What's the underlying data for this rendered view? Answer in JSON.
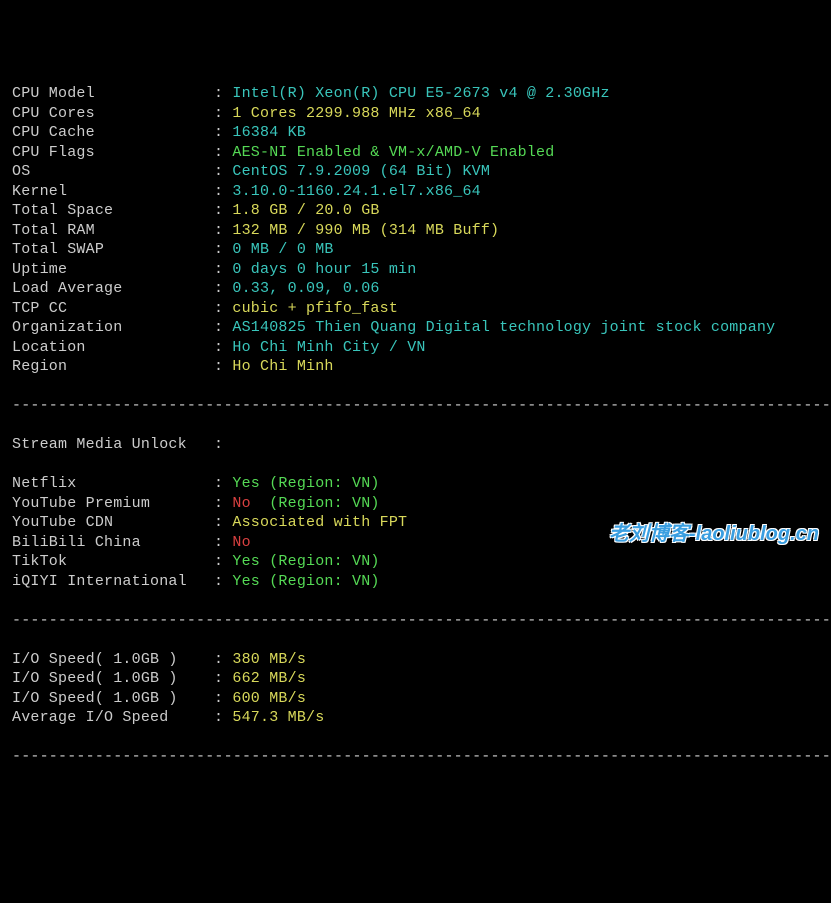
{
  "sysinfo": [
    {
      "label": "CPU Model",
      "value": "Intel(R) Xeon(R) CPU E5-2673 v4 @ 2.30GHz",
      "cls": "teal"
    },
    {
      "label": "CPU Cores",
      "value": "1 Cores 2299.988 MHz x86_64",
      "cls": "yellow"
    },
    {
      "label": "CPU Cache",
      "value": "16384 KB",
      "cls": "teal"
    },
    {
      "label": "CPU Flags",
      "value": "AES-NI Enabled & VM-x/AMD-V Enabled",
      "cls": "green"
    },
    {
      "label": "OS",
      "value": "CentOS 7.9.2009 (64 Bit) KVM",
      "cls": "teal"
    },
    {
      "label": "Kernel",
      "value": "3.10.0-1160.24.1.el7.x86_64",
      "cls": "teal"
    },
    {
      "label": "Total Space",
      "value": "1.8 GB / 20.0 GB",
      "cls": "yellow"
    },
    {
      "label": "Total RAM",
      "value": "132 MB / 990 MB (314 MB Buff)",
      "cls": "yellow"
    },
    {
      "label": "Total SWAP",
      "value": "0 MB / 0 MB",
      "cls": "teal"
    },
    {
      "label": "Uptime",
      "value": "0 days 0 hour 15 min",
      "cls": "teal"
    },
    {
      "label": "Load Average",
      "value": "0.33, 0.09, 0.06",
      "cls": "teal"
    },
    {
      "label": "TCP CC",
      "value": "cubic + pfifo_fast",
      "cls": "yellow"
    },
    {
      "label": "Organization",
      "value": "AS140825 Thien Quang Digital technology joint stock company",
      "cls": "teal"
    },
    {
      "label": "Location",
      "value": "Ho Chi Minh City / VN",
      "cls": "teal"
    },
    {
      "label": "Region",
      "value": "Ho Chi Minh",
      "cls": "yellow"
    }
  ],
  "stream_header": {
    "label": "Stream Media Unlock",
    "sep": ":"
  },
  "stream": [
    {
      "label": "Netflix",
      "yn": "Yes",
      "yn_cls": "green",
      "extra": " (Region: VN)",
      "extra_cls": "green"
    },
    {
      "label": "YouTube Premium",
      "yn": "No",
      "yn_cls": "red",
      "extra": "  (Region: VN)",
      "extra_cls": "green"
    },
    {
      "label": "YouTube CDN",
      "yn": "",
      "yn_cls": "",
      "extra": "Associated with FPT",
      "extra_cls": "yellow"
    },
    {
      "label": "BiliBili China",
      "yn": "No",
      "yn_cls": "red",
      "extra": "",
      "extra_cls": ""
    },
    {
      "label": "TikTok",
      "yn": "Yes",
      "yn_cls": "green",
      "extra": " (Region: VN)",
      "extra_cls": "green"
    },
    {
      "label": "iQIYI International",
      "yn": "Yes",
      "yn_cls": "green",
      "extra": " (Region: VN)",
      "extra_cls": "green"
    }
  ],
  "io": [
    {
      "label": "I/O Speed( 1.0GB )",
      "value": "380 MB/s",
      "cls": "yellow"
    },
    {
      "label": "I/O Speed( 1.0GB )",
      "value": "662 MB/s",
      "cls": "yellow"
    },
    {
      "label": "I/O Speed( 1.0GB )",
      "value": "600 MB/s",
      "cls": "yellow"
    },
    {
      "label": "Average I/O Speed",
      "value": "547.3 MB/s",
      "cls": "yellow"
    }
  ],
  "divider": "----------------------------------------------------------------------------------------------------",
  "watermark": "老刘博客-laoliublog.cn"
}
